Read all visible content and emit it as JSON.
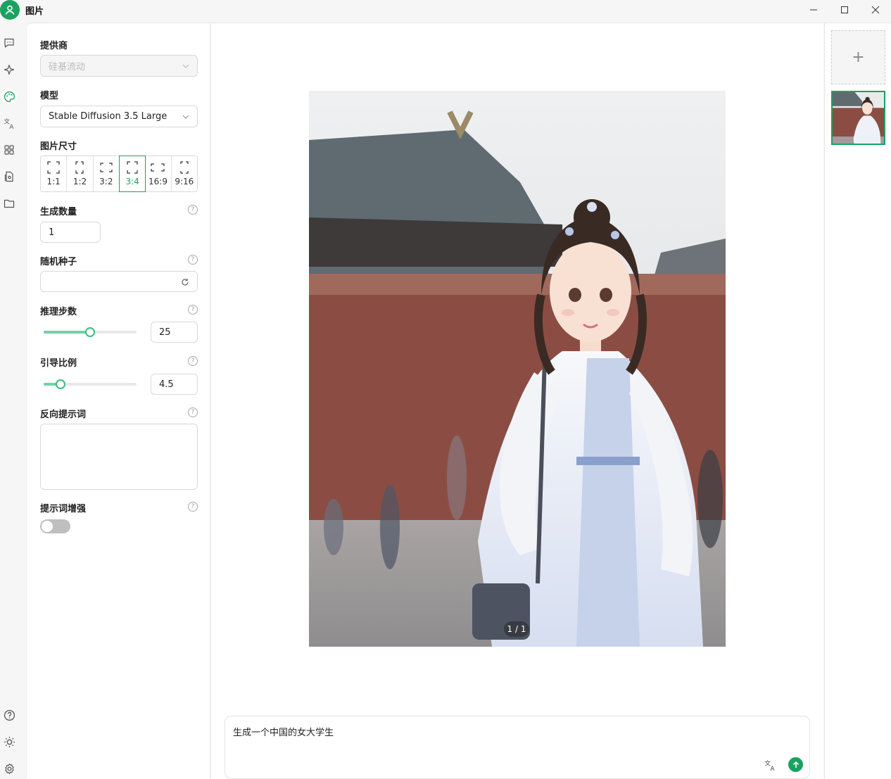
{
  "window": {
    "title": "图片"
  },
  "panel": {
    "provider": {
      "label": "提供商",
      "value": "硅基流动"
    },
    "model": {
      "label": "模型",
      "value": "Stable Diffusion 3.5 Large"
    },
    "image_size": {
      "label": "图片尺寸",
      "options": [
        "1:1",
        "1:2",
        "3:2",
        "3:4",
        "16:9",
        "9:16"
      ],
      "selected": "3:4"
    },
    "count": {
      "label": "生成数量",
      "value": "1"
    },
    "seed": {
      "label": "随机种子",
      "value": ""
    },
    "steps": {
      "label": "推理步数",
      "value": "25",
      "slider_fraction": 0.5
    },
    "guidance": {
      "label": "引导比例",
      "value": "4.5",
      "slider_fraction": 0.18
    },
    "negative_prompt": {
      "label": "反向提示词",
      "value": ""
    },
    "prompt_enhance": {
      "label": "提示词增强",
      "enabled": false
    }
  },
  "main": {
    "counter": "1 / 1",
    "prompt": "生成一个中国的女大学生"
  },
  "gallery": {
    "add_symbol": "+"
  },
  "colors": {
    "accent": "#1aa260",
    "slider": "#6fd3a3"
  }
}
